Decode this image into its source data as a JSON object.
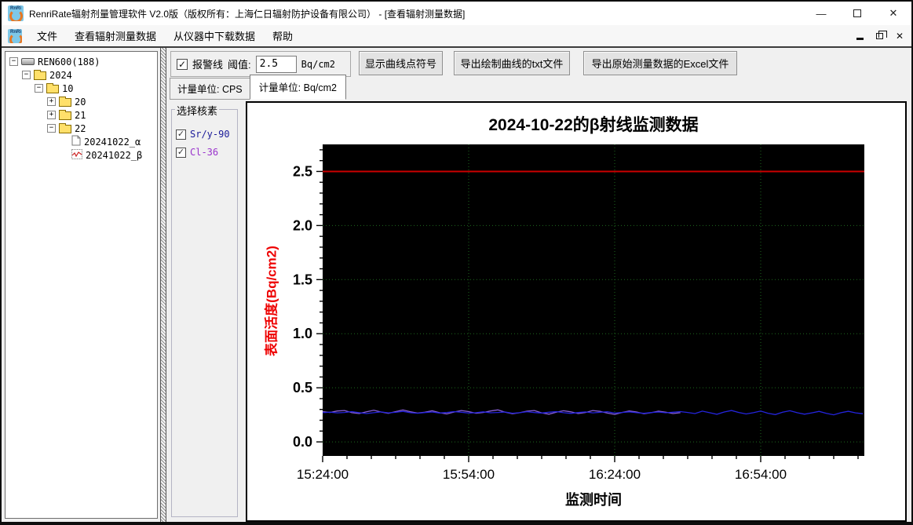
{
  "window": {
    "title": "RenriRate辐射剂量管理软件 V2.0版（版权所有：上海仁日辐射防护设备有限公司） - [查看辐射测量数据]",
    "app_icon_text": "RnRi",
    "controls": {
      "minimize": "—",
      "maximize": "",
      "close": "✕"
    }
  },
  "menu": {
    "items": [
      "文件",
      "查看辐射测量数据",
      "从仪器中下载数据",
      "帮助"
    ]
  },
  "tree": {
    "items": [
      {
        "label": "REN600(188)",
        "depth": 0,
        "expander": "−",
        "icon": "device-icon"
      },
      {
        "label": "2024",
        "depth": 1,
        "expander": "−",
        "icon": "folder-icon"
      },
      {
        "label": "10",
        "depth": 2,
        "expander": "−",
        "icon": "folder-icon"
      },
      {
        "label": "20",
        "depth": 3,
        "expander": "+",
        "icon": "folder-icon"
      },
      {
        "label": "21",
        "depth": 3,
        "expander": "+",
        "icon": "folder-icon"
      },
      {
        "label": "22",
        "depth": 3,
        "expander": "−",
        "icon": "folder-icon"
      },
      {
        "label": "20241022_α",
        "depth": 4,
        "expander": "",
        "icon": "document-icon"
      },
      {
        "label": "20241022_β",
        "depth": 4,
        "expander": "",
        "icon": "chart-file-icon"
      }
    ]
  },
  "toolbar": {
    "alarm_checkbox_label": "报警线",
    "alarm_checked": true,
    "checkmark": "✓",
    "threshold_label": "阈值:",
    "threshold_value": "2.5",
    "threshold_unit": "Bq/cm2",
    "buttons": [
      "显示曲线点符号",
      "导出绘制曲线的txt文件",
      "导出原始测量数据的Excel文件"
    ]
  },
  "tabs": [
    {
      "label": "计量单位: CPS",
      "active": false
    },
    {
      "label": "计量单位: Bq/cm2",
      "active": true
    }
  ],
  "nuclide_panel": {
    "title": "选择核素",
    "items": [
      {
        "label": "Sr/y-90",
        "checked": true,
        "color": "#1a1a99"
      },
      {
        "label": "Cl-36",
        "checked": true,
        "color": "#9933cc"
      }
    ]
  },
  "chart_data": {
    "type": "line",
    "title": "2024-10-22的β射线监测数据",
    "xlabel": "监测时间",
    "ylabel": "表面活度(Bq/cm2)",
    "plot_bg": "#000000",
    "grid_color": "#1e6a1e",
    "grid_on": true,
    "x_ticks": [
      "15:24:00",
      "15:54:00",
      "16:24:00",
      "16:54:00"
    ],
    "x_tick_minutes": [
      0,
      30,
      60,
      90
    ],
    "x_minor_step_minutes": 5,
    "x_range_minutes": [
      0,
      111
    ],
    "y_ticks": [
      0.0,
      0.5,
      1.0,
      1.5,
      2.0,
      2.5
    ],
    "y_minor_step": 0.1,
    "ylim": [
      -0.13,
      2.75
    ],
    "alarm_line": {
      "value": 2.5,
      "color": "#cc0000"
    },
    "series": [
      {
        "name": "Sr/y-90",
        "color": "#2424dd",
        "start_minute": 0,
        "step_minutes": 1.5,
        "values": [
          0.27,
          0.275,
          0.268,
          0.272,
          0.28,
          0.27,
          0.262,
          0.27,
          0.277,
          0.268,
          0.273,
          0.282,
          0.27,
          0.265,
          0.271,
          0.276,
          0.267,
          0.272,
          0.28,
          0.274,
          0.266,
          0.27,
          0.278,
          0.269,
          0.272,
          0.276,
          0.265,
          0.27,
          0.279,
          0.271,
          0.267,
          0.274,
          0.28,
          0.27,
          0.263,
          0.271,
          0.277,
          0.268,
          0.273,
          0.279,
          0.266,
          0.272,
          0.278,
          0.27,
          0.264,
          0.271,
          0.276,
          0.269,
          0.274,
          0.28,
          0.272,
          0.262,
          0.284,
          0.27,
          0.255,
          0.276,
          0.29,
          0.272,
          0.258,
          0.27,
          0.285,
          0.265,
          0.252,
          0.274,
          0.288,
          0.27,
          0.256,
          0.268,
          0.282,
          0.264,
          0.25,
          0.27,
          0.283,
          0.268,
          0.26
        ]
      },
      {
        "name": "Cl-36",
        "color": "#8a5fd6",
        "start_minute": 0,
        "step_minutes": 1.5,
        "values": [
          0.28,
          0.272,
          0.286,
          0.29,
          0.27,
          0.262,
          0.278,
          0.292,
          0.276,
          0.264,
          0.28,
          0.295,
          0.279,
          0.266,
          0.274,
          0.288,
          0.27,
          0.258,
          0.276,
          0.29,
          0.28,
          0.265,
          0.272,
          0.286,
          0.296,
          0.274,
          0.26,
          0.27,
          0.284,
          0.29,
          0.268,
          0.256,
          0.274,
          0.288,
          0.278,
          0.262,
          0.272,
          0.29,
          0.282,
          0.266,
          0.254,
          0.272,
          0.286,
          0.276,
          0.26,
          0.27,
          0.284,
          0.274,
          0.262,
          0.27
        ]
      }
    ]
  }
}
